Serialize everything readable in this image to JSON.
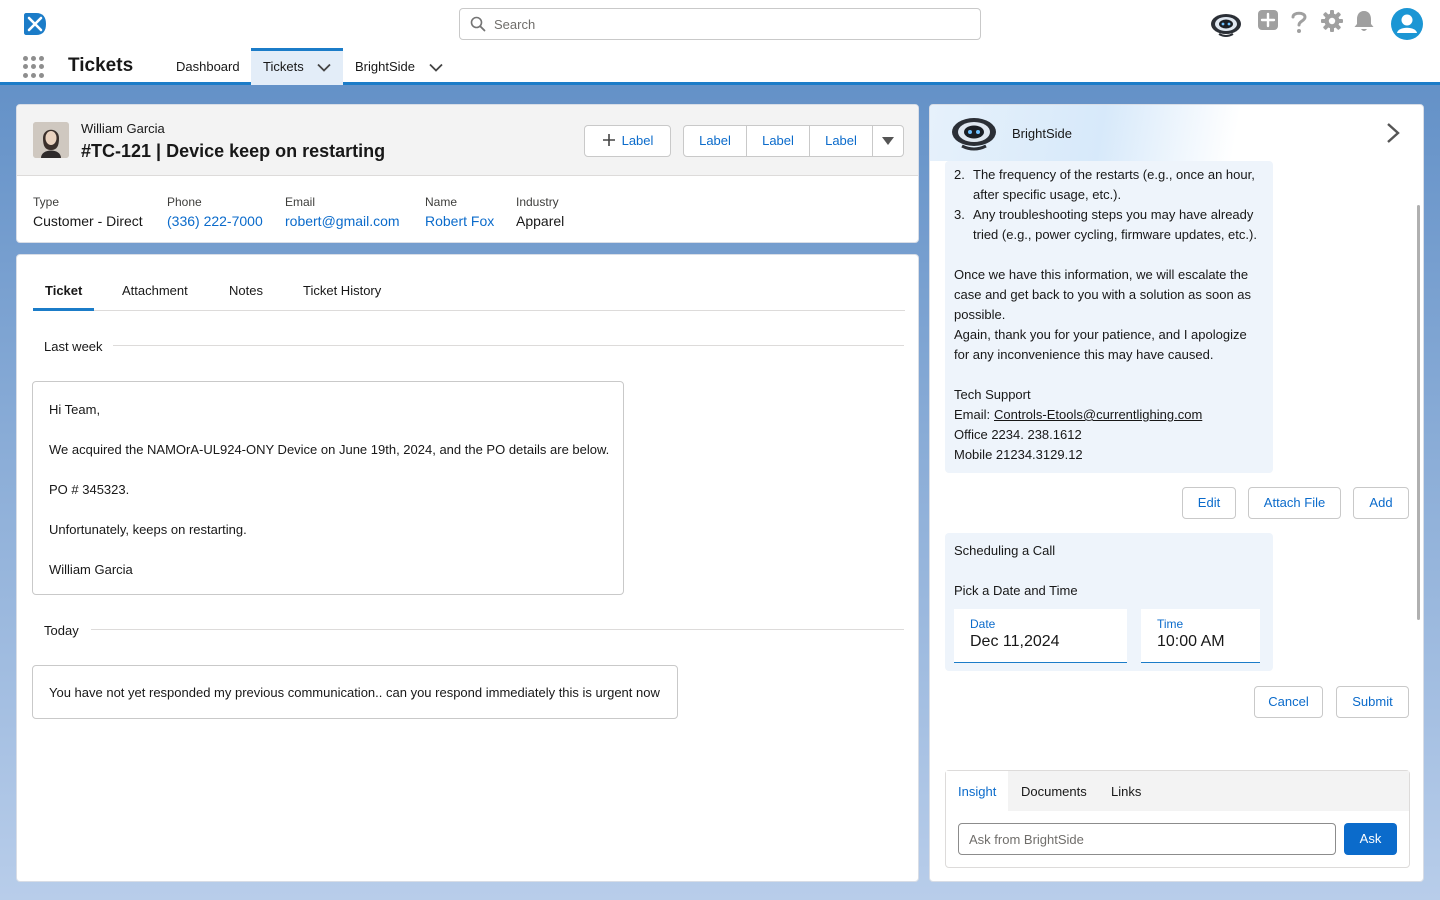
{
  "header": {
    "search_placeholder": "Search",
    "icons": [
      "app-logo-icon",
      "bot-icon",
      "add-icon",
      "help-icon",
      "settings-icon",
      "notifications-icon",
      "user-avatar-icon"
    ]
  },
  "nav": {
    "app_name": "Tickets",
    "tabs": [
      {
        "label": "Dashboard",
        "active": false
      },
      {
        "label": "Tickets",
        "active": true,
        "has_menu": true
      },
      {
        "label": "BrightSide",
        "active": false,
        "has_menu": true
      }
    ]
  },
  "record": {
    "contact_name": "William Garcia",
    "title": "#TC-121 | Device keep on restarting",
    "add_label_button": "Label",
    "group_buttons": [
      "Label",
      "Label",
      "Label"
    ],
    "fields": [
      {
        "label": "Type",
        "value": "Customer - Direct",
        "link": false
      },
      {
        "label": "Phone",
        "value": "(336) 222-7000",
        "link": true
      },
      {
        "label": "Email",
        "value": "robert@gmail.com",
        "link": true
      },
      {
        "label": "Name",
        "value": "Robert Fox",
        "link": true
      },
      {
        "label": "Industry",
        "value": "Apparel",
        "link": false
      }
    ]
  },
  "detail": {
    "tabs": [
      "Ticket",
      "Attachment",
      "Notes",
      "Ticket History"
    ],
    "active_tab": "Ticket",
    "sections": [
      {
        "label": "Last week",
        "message_lines": [
          "Hi Team,",
          "We acquired the NAMOrA-UL924-ONY Device on June 19th, 2024, and the PO details are below.",
          "PO # 345323.",
          "Unfortunately, keeps on restarting.",
          "William Garcia"
        ]
      },
      {
        "label": "Today",
        "message_lines": [
          "You have not yet responded my previous communication.. can you respond immediately this is urgent now"
        ]
      }
    ]
  },
  "assistant": {
    "name": "BrightSide",
    "reply": {
      "list_items": [
        {
          "num": "2.",
          "lines": [
            "The frequency of the restarts (e.g., once an hour,",
            "after specific usage, etc.)."
          ]
        },
        {
          "num": "3.",
          "lines": [
            "Any troubleshooting steps you may have already",
            "tried (e.g., power cycling, firmware updates, etc.)."
          ]
        }
      ],
      "paragraph_lines": [
        "Once we have this information, we will escalate the",
        "case and get back to you with a solution as soon as",
        "possible.",
        "Again, thank you for your patience, and I apologize",
        "for any inconvenience this may have caused."
      ],
      "signature": "Tech Support",
      "email_label": "Email:",
      "email": "Controls-Etools@currentlighing.com",
      "office": "Office 2234. 238.1612",
      "mobile": "Mobile 21234.3129.12"
    },
    "reply_actions": [
      "Edit",
      "Attach File",
      "Add"
    ],
    "schedule": {
      "title": "Scheduling a Call",
      "subtitle": "Pick a Date and Time",
      "date_label": "Date",
      "date_value": "Dec 11,2024",
      "time_label": "Time",
      "time_value": "10:00 AM"
    },
    "schedule_actions": [
      "Cancel",
      "Submit"
    ],
    "bottom_tabs": [
      "Insight",
      "Documents",
      "Links"
    ],
    "ask_placeholder": "Ask from BrightSide",
    "ask_button": "Ask"
  },
  "colors": {
    "accent": "#1b7cc8",
    "link": "#0b6bcb",
    "avatar": "#1b96d4"
  }
}
